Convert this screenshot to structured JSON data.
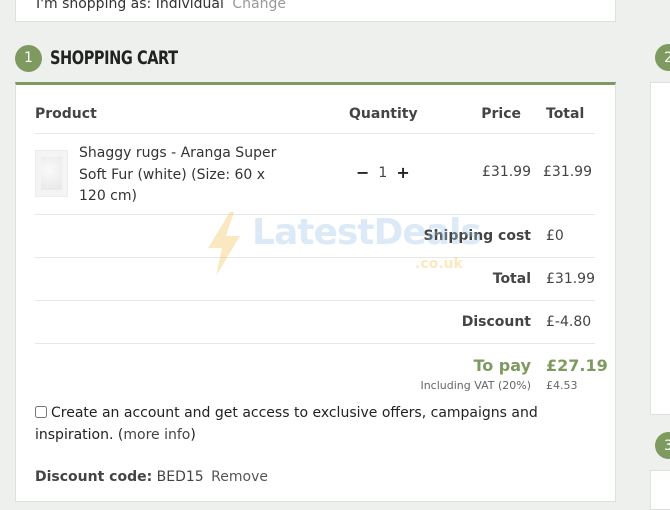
{
  "account": {
    "shopping_as": "I'm shopping as: Individual",
    "change": "Change"
  },
  "cart_section": {
    "step": "1",
    "title": "SHOPPING CART"
  },
  "table": {
    "headers": {
      "product": "Product",
      "quantity": "Quantity",
      "price": "Price",
      "total": "Total"
    },
    "item": {
      "name": "Shaggy rugs - Aranga Super Soft Fur (white) (Size: 60 x 120 cm)",
      "minus": "−",
      "quantity": "1",
      "plus": "+",
      "price": "£31.99",
      "total": "£31.99"
    }
  },
  "summary": {
    "shipping_label": "Shipping cost",
    "shipping_value": "£0",
    "total_label": "Total",
    "total_value": "£31.99",
    "discount_label": "Discount",
    "discount_value": "£-4.80",
    "topay_label": "To pay",
    "topay_value": "£27.19",
    "vat_label": "Including VAT (20%)",
    "vat_value": "£4.53"
  },
  "create_account": {
    "text": "Create an account and get access to exclusive offers, campaigns and inspiration. (",
    "more_info": "more info",
    "close": ")"
  },
  "discount_code": {
    "label": "Discount code:",
    "code": "BED15",
    "remove": "Remove"
  },
  "watermark": {
    "text": "LatestDeals",
    "sub": ".co.uk"
  },
  "right_steps": [
    "2",
    "3"
  ],
  "colors": {
    "accent": "#7f9a60",
    "background": "#eef0ee"
  }
}
